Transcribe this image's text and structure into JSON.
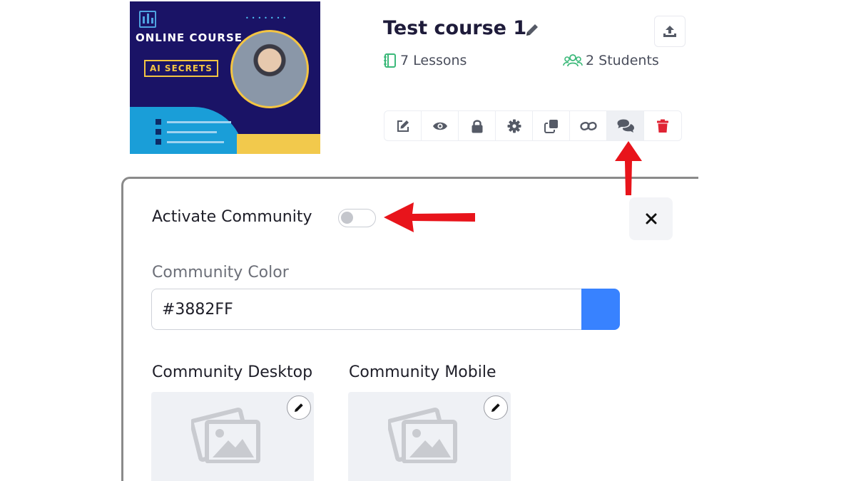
{
  "course": {
    "thumbnail": {
      "title": "ONLINE COURSE",
      "badge": "AI SECRETS"
    },
    "title": "Test course 1",
    "lessons": "7 Lessons",
    "students": "2 Students",
    "toolbar": [
      "edit-icon",
      "eye-icon",
      "lock-icon",
      "gear-icon",
      "copy-icon",
      "link-icon",
      "comments-icon",
      "trash-icon"
    ],
    "active_tool": "comments-icon"
  },
  "community": {
    "activate_label": "Activate Community",
    "activate_on": false,
    "color_label": "Community Color",
    "color_value": "#3882FF",
    "desktop_label": "Community Desktop",
    "mobile_label": "Community Mobile"
  },
  "colors": {
    "title": "#1e1b3a",
    "accent_green": "#3cb97a",
    "delete_red": "#e02434",
    "annotation_red": "#e8141b",
    "swatch": "#3882FF"
  }
}
